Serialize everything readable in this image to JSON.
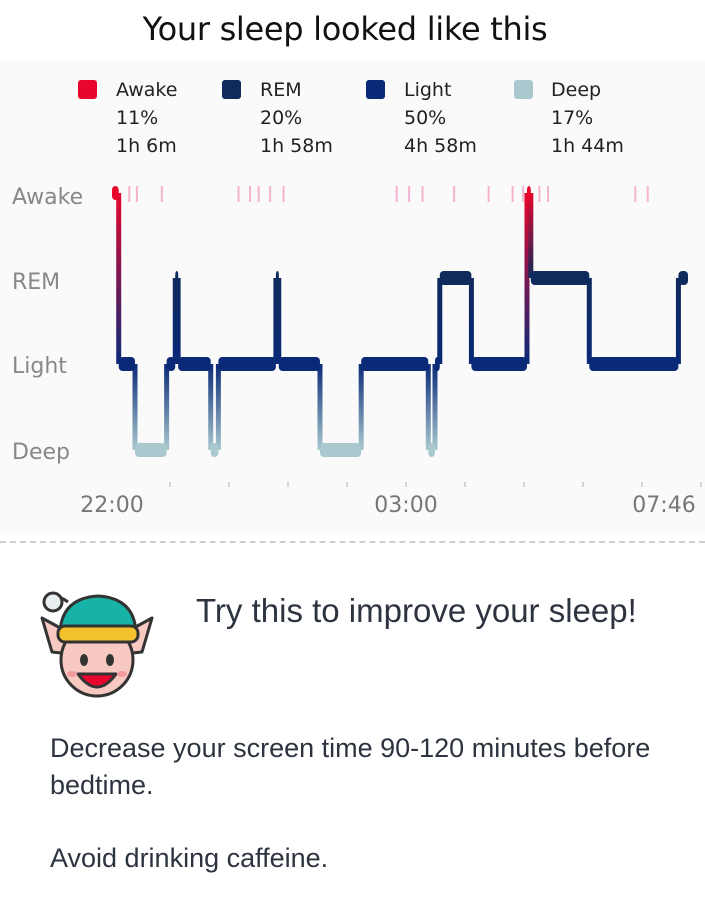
{
  "title": "Your sleep looked like this",
  "legend": [
    {
      "name": "Awake",
      "percent": "11%",
      "duration": "1h 6m",
      "color": "#e8062d"
    },
    {
      "name": "REM",
      "percent": "20%",
      "duration": "1h 58m",
      "color": "#0f2a5c"
    },
    {
      "name": "Light",
      "percent": "50%",
      "duration": "4h 58m",
      "color": "#0a2a78"
    },
    {
      "name": "Deep",
      "percent": "17%",
      "duration": "1h 44m",
      "color": "#a9c9cf"
    }
  ],
  "chart_data": {
    "type": "line",
    "y_categories": [
      "Awake",
      "REM",
      "Light",
      "Deep"
    ],
    "x_tick_labels": [
      "22:00",
      "03:00",
      "07:46"
    ],
    "x_range": [
      "21:45",
      "07:46"
    ],
    "segments": [
      {
        "stage": "Awake",
        "start": "21:45",
        "end": "21:52"
      },
      {
        "stage": "Light",
        "start": "21:52",
        "end": "22:09"
      },
      {
        "stage": "Deep",
        "start": "22:09",
        "end": "22:42"
      },
      {
        "stage": "Light",
        "start": "22:42",
        "end": "22:51"
      },
      {
        "stage": "REM",
        "start": "22:51",
        "end": "22:54"
      },
      {
        "stage": "Light",
        "start": "22:54",
        "end": "23:28"
      },
      {
        "stage": "Deep",
        "start": "23:28",
        "end": "23:36"
      },
      {
        "stage": "Light",
        "start": "23:36",
        "end": "00:36"
      },
      {
        "stage": "REM",
        "start": "00:36",
        "end": "00:39"
      },
      {
        "stage": "Light",
        "start": "00:39",
        "end": "01:22"
      },
      {
        "stage": "Deep",
        "start": "01:22",
        "end": "02:05"
      },
      {
        "stage": "Light",
        "start": "02:05",
        "end": "03:15"
      },
      {
        "stage": "Deep",
        "start": "03:15",
        "end": "03:22"
      },
      {
        "stage": "Light",
        "start": "03:22",
        "end": "03:27"
      },
      {
        "stage": "REM",
        "start": "03:27",
        "end": "04:00"
      },
      {
        "stage": "Light",
        "start": "04:00",
        "end": "04:58"
      },
      {
        "stage": "Awake",
        "start": "04:58",
        "end": "05:02"
      },
      {
        "stage": "REM",
        "start": "05:02",
        "end": "06:03"
      },
      {
        "stage": "Light",
        "start": "06:03",
        "end": "07:36"
      },
      {
        "stage": "REM",
        "start": "07:36",
        "end": "07:46"
      }
    ],
    "awake_ticks": [
      "22:03",
      "22:11",
      "22:37",
      "23:57",
      "00:09",
      "00:18",
      "00:30",
      "00:44",
      "02:42",
      "02:55",
      "03:09",
      "03:42",
      "04:18",
      "04:43",
      "04:54",
      "05:11",
      "05:20",
      "06:51",
      "07:04"
    ]
  },
  "tip_heading": "Try this to improve your sleep!",
  "tips": [
    "Decrease your screen time 90-120 minutes before bedtime.",
    "Avoid drinking caffeine."
  ],
  "icons": {
    "elf": "elf-face-icon"
  }
}
